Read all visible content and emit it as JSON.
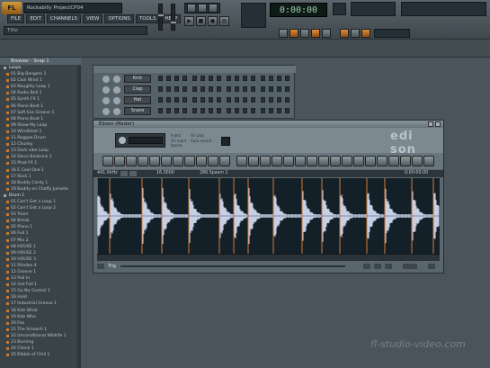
{
  "app": {
    "logo": "FL",
    "project_title": "Rockabilly ProjectCP04",
    "hint": "Title"
  },
  "menu": [
    "FILE",
    "EDIT",
    "CHANNELS",
    "VIEW",
    "OPTIONS",
    "TOOLS",
    "HELP"
  ],
  "transport": {
    "time_display": "0:00:00",
    "buttons": [
      "play",
      "stop",
      "record",
      "pattern"
    ]
  },
  "browser": {
    "header": "Browser - Snap 1",
    "items": [
      {
        "label": "Loops",
        "folder": true
      },
      {
        "label": "01 Big Bangers 1"
      },
      {
        "label": "02 Cool Wind 1"
      },
      {
        "label": "03 Naughty Loop 1"
      },
      {
        "label": "04 Radio Bell 1"
      },
      {
        "label": "05 Synth FX 1"
      },
      {
        "label": "06 Piano Beat 1"
      },
      {
        "label": "07 Soft Eco Groove 1"
      },
      {
        "label": "08 Piano Beat 1"
      },
      {
        "label": "09 Show My Loop"
      },
      {
        "label": "10 Windblast 1"
      },
      {
        "label": "11 Reggae Drum"
      },
      {
        "label": "12 Chunky"
      },
      {
        "label": "13 Dark vibe Loop"
      },
      {
        "label": "14 Disco Beatnick 1"
      },
      {
        "label": "15 Phat FX 1"
      },
      {
        "label": "16 E Cool One 1"
      },
      {
        "label": "17 Rock 1"
      },
      {
        "label": "18 Buddy Cardy 1"
      },
      {
        "label": "19 Buddy on Chaffy Jumelle"
      },
      {
        "label": "Drum 1",
        "folder": true
      },
      {
        "label": "01 Can't Get a Loop 1"
      },
      {
        "label": "02 Can't Get a Loop 2"
      },
      {
        "label": "03 Team"
      },
      {
        "label": "04 Break"
      },
      {
        "label": "05 Piano 1"
      },
      {
        "label": "06 Full 1"
      },
      {
        "label": "07 Mix 2"
      },
      {
        "label": "08 HOUSE 1"
      },
      {
        "label": "09 HOUSE 2"
      },
      {
        "label": "10 HOUSE 3"
      },
      {
        "label": "11 Rhodes 4"
      },
      {
        "label": "12 Groove 1"
      },
      {
        "label": "13 Pull In"
      },
      {
        "label": "14 Get Full 1"
      },
      {
        "label": "15 Go No Control 1"
      },
      {
        "label": "16 Hold"
      },
      {
        "label": "17 Industrial Groove 1"
      },
      {
        "label": "18 Kite What"
      },
      {
        "label": "19 Kite Who"
      },
      {
        "label": "20 Fox"
      },
      {
        "label": "21 The Smooch 1"
      },
      {
        "label": "22 Unconditional Wildlife 1"
      },
      {
        "label": "23 Burning"
      },
      {
        "label": "24 Check 1"
      },
      {
        "label": "25 Ribble of Chill 1"
      }
    ]
  },
  "stepseq": {
    "channels": [
      "Kick",
      "Clap",
      "Hat",
      "Snare"
    ]
  },
  "edison": {
    "title": "Edison (Master)",
    "logo": "edi son",
    "info_left": "441.0kHz",
    "info_mid": "16.0000",
    "info_track": "286 Spasm 1",
    "info_right": "0:00:00:00",
    "bottom_left": "Trig",
    "options": [
      "Inject",
      "On input",
      "Ignore",
      "On play",
      "Auto record"
    ]
  },
  "watermark": "fl-studio-video.com",
  "colors": {
    "accent": "#c97a2e",
    "waveform": "#c7cfe6",
    "lcd_text": "#9ecfae"
  }
}
